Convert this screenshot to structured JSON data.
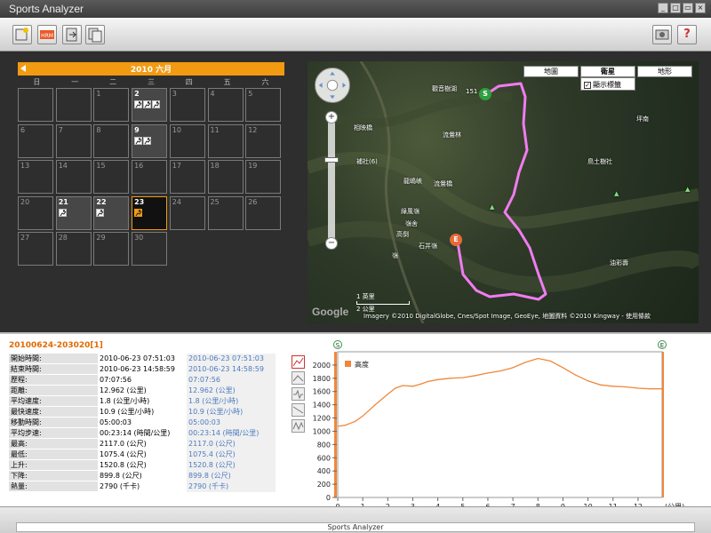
{
  "app": {
    "title": "Sports Analyzer"
  },
  "window_buttons": [
    "minimize",
    "restore",
    "maximize",
    "close"
  ],
  "toolbar": {
    "left_buttons": [
      "add-workout-icon",
      "hrm-import-icon",
      "export-icon",
      "copy-icon"
    ],
    "right_buttons": [
      "settings-icon",
      "help-icon"
    ],
    "help_label": "?"
  },
  "calendar": {
    "month_label": "2010 六月",
    "weekdays": [
      "日",
      "一",
      "二",
      "三",
      "四",
      "五",
      "六"
    ],
    "days": [
      {
        "n": "",
        "col": 0,
        "row": 0,
        "blank": true
      },
      {
        "n": "",
        "col": 1,
        "row": 0,
        "blank": true
      },
      {
        "n": "1",
        "col": 2,
        "row": 0
      },
      {
        "n": "2",
        "col": 3,
        "row": 0,
        "acts": 3
      },
      {
        "n": "3",
        "col": 4,
        "row": 0
      },
      {
        "n": "4",
        "col": 5,
        "row": 0
      },
      {
        "n": "5",
        "col": 6,
        "row": 0
      },
      {
        "n": "6",
        "col": 0,
        "row": 1
      },
      {
        "n": "7",
        "col": 1,
        "row": 1
      },
      {
        "n": "8",
        "col": 2,
        "row": 1
      },
      {
        "n": "9",
        "col": 3,
        "row": 1,
        "acts": 2
      },
      {
        "n": "10",
        "col": 4,
        "row": 1
      },
      {
        "n": "11",
        "col": 5,
        "row": 1
      },
      {
        "n": "12",
        "col": 6,
        "row": 1
      },
      {
        "n": "13",
        "col": 0,
        "row": 2
      },
      {
        "n": "14",
        "col": 1,
        "row": 2
      },
      {
        "n": "15",
        "col": 2,
        "row": 2
      },
      {
        "n": "16",
        "col": 3,
        "row": 2
      },
      {
        "n": "17",
        "col": 4,
        "row": 2
      },
      {
        "n": "18",
        "col": 5,
        "row": 2
      },
      {
        "n": "19",
        "col": 6,
        "row": 2
      },
      {
        "n": "20",
        "col": 0,
        "row": 3
      },
      {
        "n": "21",
        "col": 1,
        "row": 3,
        "acts": 1
      },
      {
        "n": "22",
        "col": 2,
        "row": 3,
        "acts": 1
      },
      {
        "n": "23",
        "col": 3,
        "row": 3,
        "acts": 1,
        "selected": true
      },
      {
        "n": "24",
        "col": 4,
        "row": 3
      },
      {
        "n": "25",
        "col": 5,
        "row": 3
      },
      {
        "n": "26",
        "col": 6,
        "row": 3
      },
      {
        "n": "27",
        "col": 0,
        "row": 4
      },
      {
        "n": "28",
        "col": 1,
        "row": 4
      },
      {
        "n": "29",
        "col": 2,
        "row": 4
      },
      {
        "n": "30",
        "col": 3,
        "row": 4
      }
    ]
  },
  "map": {
    "types": [
      "地圖",
      "衛星",
      "地形"
    ],
    "active_type": "衛星",
    "labels_checkbox": "顯示標籤",
    "labels_checked": "✓",
    "place_labels": [
      {
        "text": "觀音樹湖",
        "x": 140,
        "y": 26
      },
      {
        "text": "151",
        "x": 178,
        "y": 30
      },
      {
        "text": "相映橋",
        "x": 52,
        "y": 70
      },
      {
        "text": "流鶯林",
        "x": 152,
        "y": 78
      },
      {
        "text": "補社(6)",
        "x": 55,
        "y": 108
      },
      {
        "text": "流鶯橋",
        "x": 142,
        "y": 133
      },
      {
        "text": "龍嶋峽",
        "x": 108,
        "y": 130
      },
      {
        "text": "綠風嶺",
        "x": 105,
        "y": 164
      },
      {
        "text": "鳥土樹社",
        "x": 315,
        "y": 108
      },
      {
        "text": "坪南",
        "x": 370,
        "y": 60
      },
      {
        "text": "石并嶺",
        "x": 125,
        "y": 203
      },
      {
        "text": "高倒",
        "x": 100,
        "y": 190
      },
      {
        "text": "嶺舍",
        "x": 110,
        "y": 178
      },
      {
        "text": "油彩壽",
        "x": 340,
        "y": 222
      },
      {
        "text": "嶺",
        "x": 95,
        "y": 214
      }
    ],
    "start_marker": "S",
    "end_marker": "E",
    "scale_km": "1 英里",
    "scale_mi": "2 公里",
    "copyright": "Imagery ©2010 DigitalGlobe, Cnes/Spot Image, GeoEye, 地圖資料 ©2010 Kingway - 使用條款",
    "google_logo": "Google",
    "zoom_in": "+",
    "zoom_out": "−"
  },
  "workout": {
    "title": "20100624-203020[1]",
    "stats": [
      {
        "label": "開始時間:",
        "v1": "2010-06-23 07:51:03",
        "v2": "2010-06-23 07:51:03"
      },
      {
        "label": "結束時間:",
        "v1": "2010-06-23 14:58:59",
        "v2": "2010-06-23 14:58:59"
      },
      {
        "label": "歷程:",
        "v1": "07:07:56",
        "v2": "07:07:56"
      },
      {
        "label": "距離:",
        "v1": "12.962 (公里)",
        "v2": "12.962 (公里)"
      },
      {
        "label": "平均速度:",
        "v1": "1.8 (公里/小時)",
        "v2": "1.8 (公里/小時)"
      },
      {
        "label": "最快速度:",
        "v1": "10.9 (公里/小時)",
        "v2": "10.9 (公里/小時)"
      },
      {
        "label": "移動時間:",
        "v1": "05:00:03",
        "v2": "05:00:03"
      },
      {
        "label": "平均步速:",
        "v1": "00:23:14 (時間/公里)",
        "v2": "00:23:14 (時間/公里)"
      },
      {
        "label": "最高:",
        "v1": "2117.0 (公尺)",
        "v2": "2117.0 (公尺)"
      },
      {
        "label": "最低:",
        "v1": "1075.4 (公尺)",
        "v2": "1075.4 (公尺)"
      },
      {
        "label": "上升:",
        "v1": "1520.8 (公尺)",
        "v2": "1520.8 (公尺)"
      },
      {
        "label": "下降:",
        "v1": "899.8 (公尺)",
        "v2": "899.8 (公尺)"
      },
      {
        "label": "熱量:",
        "v1": "2790 (千卡)",
        "v2": "2790 (千卡)"
      }
    ]
  },
  "chart_tools": [
    "altitude-tool-icon",
    "speed-tool-icon",
    "heartrate-tool-icon",
    "pace-tool-icon",
    "cadence-tool-icon"
  ],
  "chart_data": {
    "type": "line",
    "title": "",
    "xlabel": "(公里)",
    "ylabel": "",
    "legend": "高度",
    "legend_placement": "top-left",
    "xlim": [
      0,
      12.962
    ],
    "ylim": [
      0,
      2200
    ],
    "x_ticks": [
      0,
      1,
      2,
      3,
      4,
      5,
      6,
      7,
      8,
      9,
      10,
      11,
      12
    ],
    "y_ticks": [
      0,
      200,
      400,
      600,
      800,
      1000,
      1200,
      1400,
      1600,
      1800,
      2000
    ],
    "start_marker": "S",
    "end_marker": "E",
    "series": [
      {
        "name": "高度",
        "color": "#f0883a",
        "x": [
          0,
          0.3,
          0.7,
          1.0,
          1.5,
          2.0,
          2.3,
          2.6,
          3.0,
          3.3,
          3.6,
          4.0,
          4.5,
          5.0,
          5.5,
          6.0,
          6.5,
          7.0,
          7.5,
          8.0,
          8.5,
          9.0,
          9.5,
          10.0,
          10.5,
          11.0,
          11.5,
          12.0,
          12.5,
          12.962
        ],
        "values": [
          1075,
          1090,
          1150,
          1230,
          1400,
          1560,
          1650,
          1690,
          1680,
          1710,
          1750,
          1780,
          1800,
          1810,
          1840,
          1880,
          1910,
          1960,
          2040,
          2100,
          2060,
          1960,
          1850,
          1760,
          1700,
          1680,
          1670,
          1650,
          1640,
          1640
        ]
      }
    ]
  },
  "statusbar": {
    "text": "Sports Analyzer"
  },
  "colors": {
    "accent": "#f29a12",
    "route": "#f07cf0",
    "series": "#f0883a",
    "link": "#4a7bbf"
  }
}
